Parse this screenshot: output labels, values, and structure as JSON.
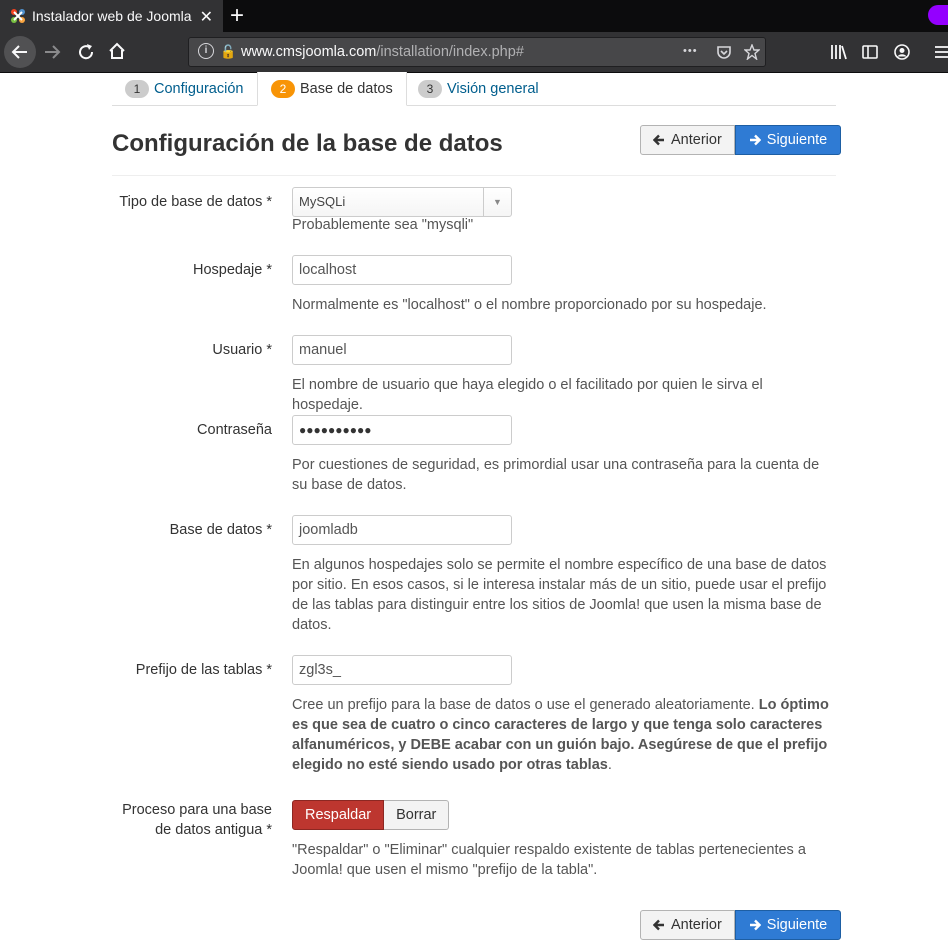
{
  "browser": {
    "tab_title": "Instalador web de Joomla",
    "url_domain": "www.cmsjoomla.com",
    "url_path": "/installation/index.php#",
    "new_tab_label": "+",
    "more_label": "•••"
  },
  "steps": [
    {
      "number": "1",
      "label": "Configuración"
    },
    {
      "number": "2",
      "label": "Base de datos"
    },
    {
      "number": "3",
      "label": "Visión general"
    }
  ],
  "page_title": "Configuración de la base de datos",
  "nav": {
    "prev": "Anterior",
    "next": "Siguiente"
  },
  "form": {
    "db_type": {
      "label": "Tipo de base de datos *",
      "value": "MySQLi",
      "help": "Probablemente sea \"mysqli\""
    },
    "host": {
      "label": "Hospedaje *",
      "value": "localhost",
      "help": "Normalmente es \"localhost\" o el nombre proporcionado por su hospedaje."
    },
    "user": {
      "label": "Usuario *",
      "value": "manuel",
      "help": "El nombre de usuario que haya elegido o el facilitado por quien le sirva el hospedaje."
    },
    "password": {
      "label": "Contraseña",
      "value": "●●●●●●●●●●",
      "help": "Por cuestiones de seguridad, es primordial usar una contraseña para la cuenta de su base de datos."
    },
    "database": {
      "label": "Base de datos *",
      "value": "joomladb",
      "help": "En algunos hospedajes solo se permite el nombre específico de una base de datos por sitio. En esos casos, si le interesa instalar más de un sitio, puede usar el prefijo de las tablas para distinguir entre los sitios de Joomla! que usen la misma base de datos."
    },
    "prefix": {
      "label": "Prefijo de las tablas *",
      "value": "zgl3s_",
      "help_plain": "Cree un prefijo para la base de datos o use el generado aleatoriamente. ",
      "help_bold": "Lo óptimo es que sea de cuatro o cinco caracteres de largo y que tenga solo caracteres alfanuméricos, y DEBE acabar con un guión bajo. Asegúrese de que el prefijo elegido no esté siendo usado por otras tablas",
      "help_end": "."
    },
    "old_db": {
      "label": "Proceso para una base de datos antigua *",
      "option_backup": "Respaldar",
      "option_delete": "Borrar",
      "help": "\"Respaldar\" o \"Eliminar\" cualquier respaldo existente de tablas pertenecientes a Joomla! que usen el mismo \"prefijo de la tabla\"."
    }
  }
}
